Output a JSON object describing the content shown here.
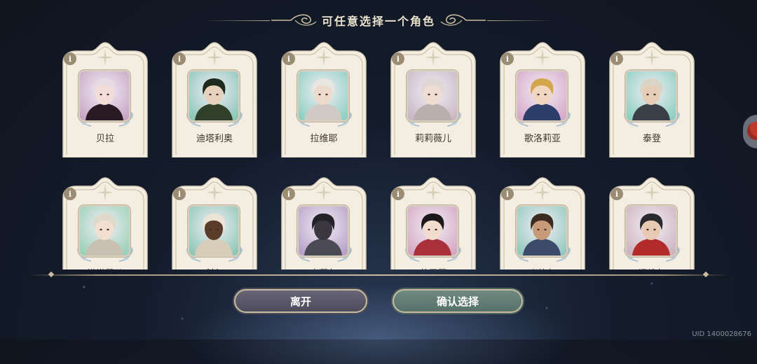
{
  "header": {
    "title": "可任意选择一个角色"
  },
  "characters": [
    {
      "name": "贝拉",
      "info": "i",
      "bg": "#c7a6c5",
      "skin": "#f3ddd8",
      "hair": "#e8dbe4",
      "accent": "#2a1a24",
      "portrait_icon": "bella-portrait"
    },
    {
      "name": "迪塔利奥",
      "info": "i",
      "bg": "#8cc6b8",
      "skin": "#e7d1bc",
      "hair": "#1f2a1e",
      "accent": "#2f3f2a",
      "portrait_icon": "ditalio-portrait"
    },
    {
      "name": "拉维耶",
      "info": "i",
      "bg": "#8fcfc2",
      "skin": "#ecdacc",
      "hair": "#e9e6e2",
      "accent": "#cfcac4",
      "portrait_icon": "laviye-portrait"
    },
    {
      "name": "莉莉薇儿",
      "info": "i",
      "bg": "#c9b8c4",
      "skin": "#efdcd2",
      "hair": "#dfd7d3",
      "accent": "#b9b0ad",
      "portrait_icon": "lilyvier-portrait"
    },
    {
      "name": "歌洛莉亚",
      "info": "i",
      "bg": "#d6a8c9",
      "skin": "#f0d5bf",
      "hair": "#d4a64c",
      "accent": "#2d3e6a",
      "portrait_icon": "gloria-portrait"
    },
    {
      "name": "泰登",
      "info": "i",
      "bg": "#8ccfc0",
      "skin": "#e5cdb8",
      "hair": "#d9d4c6",
      "accent": "#3a3f4a",
      "portrait_icon": "taiden-portrait"
    },
    {
      "name": "塔塔莉儿",
      "info": "i",
      "bg": "#9ad0b8",
      "skin": "#f1e0d2",
      "hair": "#dfd9cc",
      "accent": "#c8c0b0",
      "portrait_icon": "tatalier-portrait"
    },
    {
      "name": "科尔",
      "info": "i",
      "bg": "#8ec7b5",
      "skin": "#5b3b2a",
      "hair": "#ece4d6",
      "accent": "#d8cdb9",
      "portrait_icon": "kol-portrait"
    },
    {
      "name": "卡菲尔",
      "info": "i",
      "bg": "#b7a0c7",
      "skin": "#3a3740",
      "hair": "#232229",
      "accent": "#4b4a55",
      "portrait_icon": "kafir-portrait"
    },
    {
      "name": "茉里菲",
      "info": "i",
      "bg": "#d4a7c3",
      "skin": "#f2dccd",
      "hair": "#1c1718",
      "accent": "#a8303a",
      "portrait_icon": "morifi-portrait"
    },
    {
      "name": "米格尔",
      "info": "i",
      "bg": "#93c9bd",
      "skin": "#c79a78",
      "hair": "#3b2a20",
      "accent": "#3d4a6a",
      "portrait_icon": "miguel-portrait"
    },
    {
      "name": "泽维尔",
      "info": "i",
      "bg": "#cdb3c0",
      "skin": "#e8c9b2",
      "hair": "#2b2b2f",
      "accent": "#b22a2a",
      "portrait_icon": "xavier-portrait"
    }
  ],
  "buttons": {
    "leave": "离开",
    "confirm": "确认选择"
  },
  "uid": "UID 1400028676"
}
